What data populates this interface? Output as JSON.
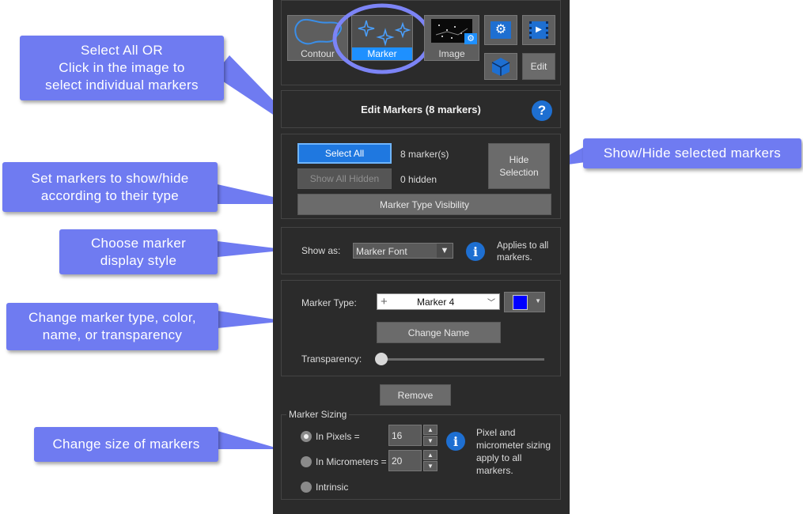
{
  "toolbar": {
    "contour_label": "Contour",
    "marker_label": "Marker",
    "image_label": "Image",
    "edit_label": "Edit"
  },
  "edit_markers": {
    "title": "Edit Markers (8 markers)",
    "help": "?"
  },
  "selection": {
    "select_all": "Select All",
    "marker_count": "8 marker(s)",
    "show_all_hidden": "Show All Hidden",
    "hidden_count": "0 hidden",
    "hide_selection": "Hide\nSelection",
    "type_visibility": "Marker Type Visibility"
  },
  "display": {
    "show_as_label": "Show as:",
    "show_as_value": "Marker Font",
    "info_text": "Applies to all\nmarkers."
  },
  "marker_type": {
    "label": "Marker Type:",
    "value": "Marker 4",
    "color": "#0000ff",
    "change_name": "Change Name",
    "transparency_label": "Transparency:",
    "transparency_value": 0
  },
  "remove_label": "Remove",
  "sizing": {
    "title": "Marker Sizing",
    "pixels_label": "In Pixels =",
    "pixels_value": "16",
    "micrometers_label": "In Micrometers =",
    "micrometers_value": "20",
    "intrinsic_label": "Intrinsic",
    "selected": "pixels",
    "info_text": "Pixel and\nmicrometer sizing\napply to all\nmarkers."
  },
  "callouts": {
    "select_all": "Select All  OR\nClick in the image to\nselect individual markers",
    "show_hide": "Show/Hide selected markers",
    "type_visibility": "Set markers to show/hide\naccording to their type",
    "display_style": "Choose marker\ndisplay style",
    "change_type": "Change marker type, color,\nname, or transparency",
    "size": "Change size of markers"
  },
  "accent_color": "#6f7bf1",
  "highlight_color": "#1e90ff"
}
